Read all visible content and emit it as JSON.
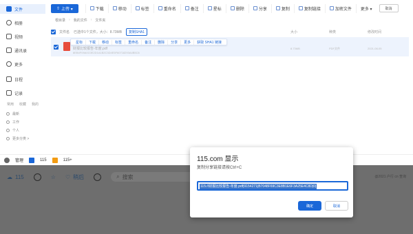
{
  "sidebar": {
    "items": [
      {
        "label": "文件",
        "icon": "file-icon"
      },
      {
        "label": "相册",
        "icon": "photo-icon"
      },
      {
        "label": "视频",
        "icon": "video-icon"
      },
      {
        "label": "通讯录",
        "icon": "contacts-icon"
      },
      {
        "label": "更多",
        "icon": "more-icon"
      },
      {
        "label": "日程",
        "icon": "calendar-icon"
      },
      {
        "label": "记录",
        "icon": "note-icon"
      }
    ],
    "tabs": [
      "常用",
      "收藏",
      "我的"
    ],
    "sub_items": [
      {
        "label": "最新"
      },
      {
        "label": "工作"
      },
      {
        "label": "个人"
      },
      {
        "label": "更多分类 >"
      }
    ]
  },
  "toolbar": {
    "upload_label": "上传 ▾",
    "buttons": [
      "下载",
      "移动",
      "标签",
      "重命名",
      "备注",
      "星标",
      "删除",
      "分享",
      "复制",
      "复制链接",
      "加密文件",
      "更多 ▾"
    ],
    "cancel_label": "取消"
  },
  "breadcrumb": [
    "根目录",
    "我的文件",
    "文件夹"
  ],
  "header_row": {
    "name_label": "文件名",
    "selection_text": "已选中1个文件，大小：8.73MB",
    "sha_button": "复制SHA1",
    "col_size": "大小",
    "col_type": "种类",
    "col_time": "修改时间"
  },
  "row_actions": [
    "星标",
    "下载",
    "移动",
    "标签",
    "重命名",
    "备注",
    "删除",
    "分享",
    "更多",
    "获取 SHA1 链接"
  ],
  "file": {
    "name": "财报比较报告-年度.pdf",
    "meta": "8EB4F09A0C0E2D1A1B2C3D4E5F60718293A4B5C6",
    "size": "8.73MB",
    "type": "PDF文件",
    "time": "2021-08-05"
  },
  "taskbar": {
    "items": [
      "管理",
      "115",
      "115+"
    ]
  },
  "lower": {
    "brand": "115",
    "nav": [
      "",
      "",
      "稍后",
      ""
    ],
    "search_placeholder": "搜索",
    "right_text": "@2021 户行 cn 查询"
  },
  "dialog": {
    "title": "115.com 显示",
    "message": "复制分享链接请按Ctrl+C",
    "value": "115://财报比较报告-年度.pdf|9154271|B7048F69C3E8B1E6F3A25E4C8D|0|",
    "ok_label": "确定",
    "cancel_label": "取消"
  },
  "colors": {
    "accent": "#1a67d8",
    "selection": "#edf3fd",
    "dimmed_bg": "#6e6e6e"
  }
}
